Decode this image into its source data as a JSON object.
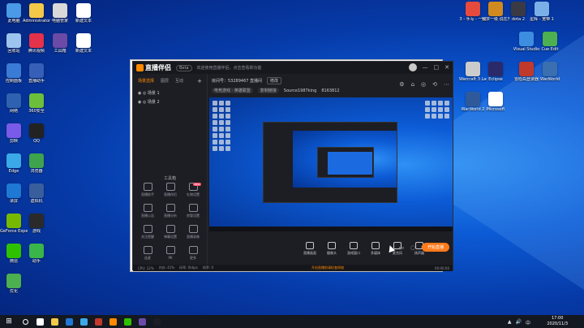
{
  "desktop": {
    "left_icons": [
      {
        "label": "此电脑",
        "color": "#4a9ae8"
      },
      {
        "label": "Administrator",
        "color": "#f3c94a"
      },
      {
        "label": "电脑管家",
        "color": "#d9d9d9"
      },
      {
        "label": "新建文本",
        "color": "#ffffff"
      },
      {
        "label": "回收站",
        "color": "#9cc4ee"
      },
      {
        "label": "腾讯视频",
        "color": "#e3324a"
      },
      {
        "label": "工具箱",
        "color": "#6b4aa8"
      },
      {
        "label": "新建文本",
        "color": "#ffffff"
      },
      {
        "label": "控制面板",
        "color": "#3a7bd5"
      },
      {
        "label": "直播助手",
        "color": "#365fb8"
      },
      {
        "label": "网络",
        "color": "#2e62b0"
      },
      {
        "label": "360安全",
        "color": "#6cbf3a"
      },
      {
        "label": "剪映",
        "color": "#7a5ae8"
      },
      {
        "label": "QQ",
        "color": "#222222"
      },
      {
        "label": "Edge",
        "color": "#3ba9e8"
      },
      {
        "label": "浏览器",
        "color": "#3fa34d"
      },
      {
        "label": "录屏",
        "color": "#1e78d4"
      },
      {
        "label": "虚拟机",
        "color": "#395e9c"
      },
      {
        "label": "GeForce Experience",
        "color": "#76b900"
      },
      {
        "label": "游戏",
        "color": "#2a2a2a"
      },
      {
        "label": "微信",
        "color": "#2dc100"
      },
      {
        "label": "助手",
        "color": "#39b54a"
      },
      {
        "label": "优化",
        "color": "#4caf50"
      }
    ],
    "right_icons": [
      {
        "label": "3 - 手写 - 一招",
        "color": "#e64a3c"
      },
      {
        "label": "我求一级 说在开在",
        "color": "#d08a20"
      },
      {
        "label": "dota 2",
        "color": "#3a3a44"
      },
      {
        "label": "星辉 - 宽带 1",
        "color": "#7ab0e8"
      },
      {
        "label": "Visual Studio",
        "color": "#3d8ee0"
      },
      {
        "label": "Cue Edit",
        "color": "#4caf50"
      },
      {
        "label": "Warcraft 3 Launcher",
        "color": "#cccccc"
      },
      {
        "label": "Eclipse",
        "color": "#2a2a6a"
      },
      {
        "label": "冒险岛登录器",
        "color": "#c0392b"
      },
      {
        "label": "WarWorld",
        "color": "#3a6fb0"
      },
      {
        "label": "WarWorld 2",
        "color": "#2e5a9c"
      },
      {
        "label": "Microsoft",
        "color": "#ffffff"
      }
    ]
  },
  "app": {
    "name": "直播伴侣",
    "version_badge": "Beta",
    "notice": "欢迎使用直播伴侣，点击查看新功能",
    "window_controls": [
      "—",
      "□",
      "✕"
    ],
    "left_tabs": [
      "场景选择",
      "图层",
      "互动"
    ],
    "scenes": [
      "场景 1",
      "场景 2"
    ],
    "tools_title": "工具箱",
    "tools": [
      {
        "label": "直播助手",
        "badge": ""
      },
      {
        "label": "直播伴侣",
        "badge": ""
      },
      {
        "label": "礼物设置",
        "badge": "NEW"
      },
      {
        "label": "直播公告",
        "badge": ""
      },
      {
        "label": "直播分析",
        "badge": ""
      },
      {
        "label": "房管设置",
        "badge": ""
      },
      {
        "label": "关注提醒",
        "badge": ""
      },
      {
        "label": "弹幕设置",
        "badge": ""
      },
      {
        "label": "直播录像",
        "badge": ""
      },
      {
        "label": "连麦",
        "badge": ""
      },
      {
        "label": "PK",
        "badge": ""
      },
      {
        "label": "更多",
        "badge": ""
      }
    ],
    "room": {
      "title": "房间号：53289467 直播间",
      "title_btn": "修改",
      "category_btn": "电竞游戏 · 英雄联盟",
      "share_btn": "复制链接",
      "stream_id": "Source1987king",
      "room_id": "8163812"
    },
    "room_icons": [
      "⚙",
      "⌂",
      "◎",
      "⟲",
      "⋯"
    ],
    "toolbar": [
      {
        "label": "直播画面"
      },
      {
        "label": "摄像头"
      },
      {
        "label": "游戏窗口"
      },
      {
        "label": "多媒体"
      },
      {
        "label": "麦克风"
      },
      {
        "label": "扬声器"
      }
    ],
    "start_btn": "开始直播",
    "status": {
      "left1": "CPU: 12%",
      "left2": "内存: 41%",
      "left3": "码率: 0kbps",
      "left4": "帧率: 0",
      "warning": "开启直播前请检查网络",
      "right": "00:00:00"
    }
  },
  "taskbar": {
    "start": "⊞",
    "apps": [
      {
        "color": "#ffffff"
      },
      {
        "color": "#f3c94a"
      },
      {
        "color": "#1e78d4"
      },
      {
        "color": "#3ba9e8"
      },
      {
        "color": "#c0392b"
      },
      {
        "color": "#ff8a00"
      },
      {
        "color": "#2dc100"
      },
      {
        "color": "#6b4aa8"
      },
      {
        "color": "#1d1e24"
      }
    ],
    "time": "17:00",
    "date": "2020/11/3",
    "tray": [
      "▲",
      "🔊",
      "中"
    ]
  }
}
